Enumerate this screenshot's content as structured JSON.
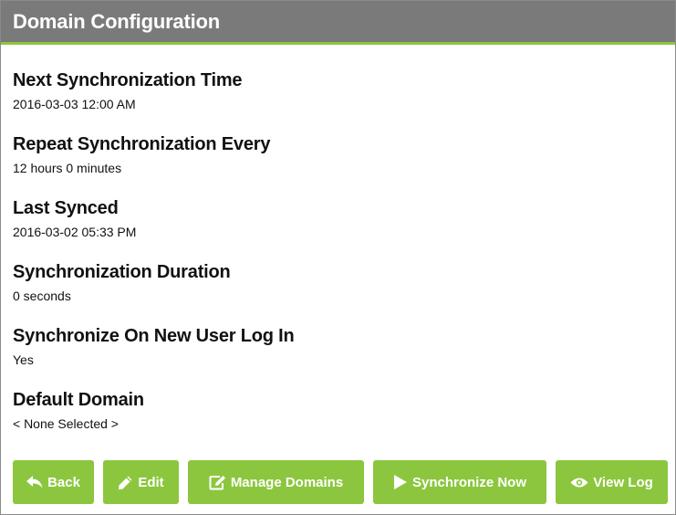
{
  "header": {
    "title": "Domain Configuration"
  },
  "fields": [
    {
      "label": "Next Synchronization Time",
      "value": "2016-03-03 12:00 AM"
    },
    {
      "label": "Repeat Synchronization Every",
      "value": "12 hours 0 minutes"
    },
    {
      "label": "Last Synced",
      "value": "2016-03-02 05:33 PM"
    },
    {
      "label": "Synchronization Duration",
      "value": "0 seconds"
    },
    {
      "label": "Synchronize On New User Log In",
      "value": "Yes"
    },
    {
      "label": "Default Domain",
      "value": "< None Selected >"
    }
  ],
  "actions": {
    "back": {
      "label": "Back",
      "icon": "reply-arrow-icon"
    },
    "edit": {
      "label": "Edit",
      "icon": "pencil-icon"
    },
    "manage": {
      "label": "Manage Domains",
      "icon": "edit-square-icon"
    },
    "sync": {
      "label": "Synchronize Now",
      "icon": "play-icon"
    },
    "log": {
      "label": "View Log",
      "icon": "eye-icon"
    }
  },
  "colors": {
    "header_bg": "#7a7a7a",
    "accent": "#8cc63f",
    "button_text": "#ffffff"
  }
}
